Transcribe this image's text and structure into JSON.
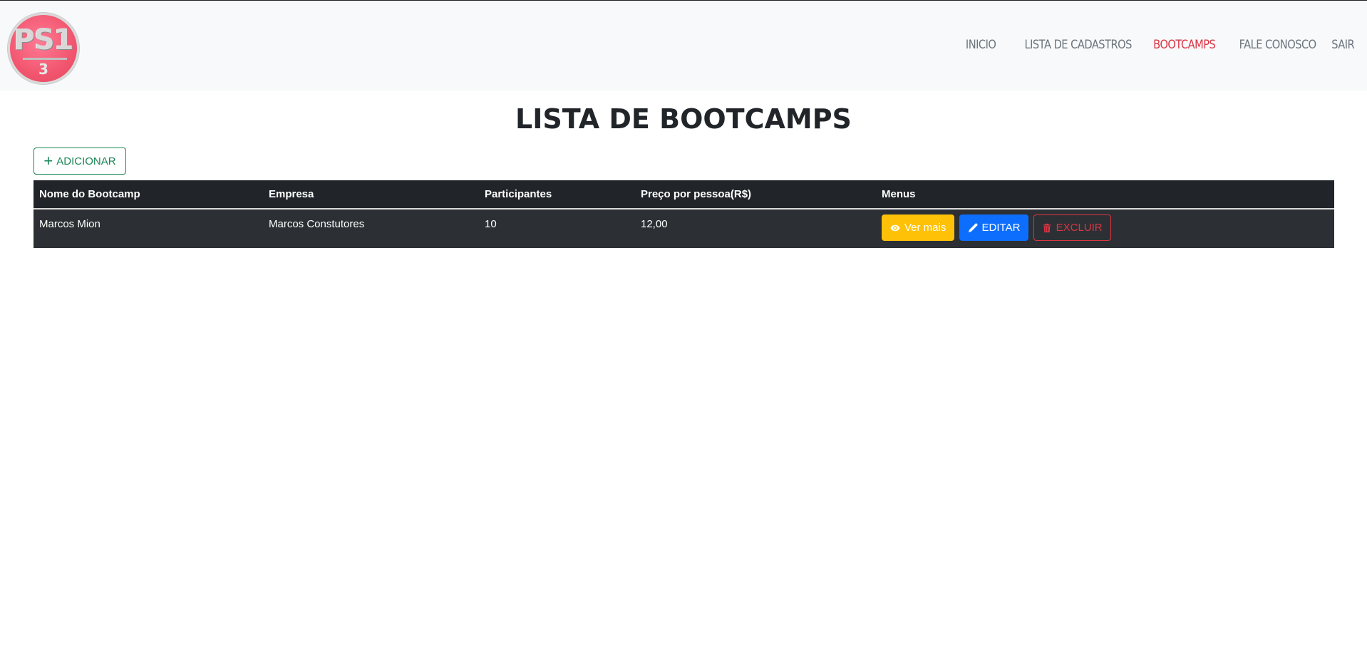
{
  "header": {
    "logo_text": "PS1",
    "logo_subtext": "3",
    "nav": [
      {
        "label": "INICIO"
      },
      {
        "label": "LISTA DE CADASTROS"
      },
      {
        "label": "BOOTCAMPS",
        "active": true
      },
      {
        "label": "FALE CONOSCO"
      },
      {
        "label": "SAIR"
      }
    ]
  },
  "main": {
    "title": "LISTA DE BOOTCAMPS",
    "add_button_label": "ADICIONAR",
    "table": {
      "columns": [
        "Nome do Bootcamp",
        "Empresa",
        "Participantes",
        "Preço por pessoa(R$)",
        "Menus"
      ],
      "rows": [
        {
          "nome": "Marcos Mion",
          "empresa": "Marcos Constutores",
          "participantes": "10",
          "preco": "12,00",
          "actions": {
            "view_label": "Ver mais",
            "edit_label": "EDITAR",
            "delete_label": "EXCLUIR"
          }
        }
      ]
    }
  },
  "colors": {
    "nav_active": "#dc3545",
    "nav_text": "#6c757d",
    "add_button": "#198754",
    "table_dark": "#212529",
    "view_button": "#ffc107",
    "edit_button": "#0d6efd",
    "delete_button": "#dc3545"
  },
  "icons": {
    "add": "plus-icon",
    "view": "eye-icon",
    "edit": "pencil-icon",
    "delete": "trash-icon"
  }
}
